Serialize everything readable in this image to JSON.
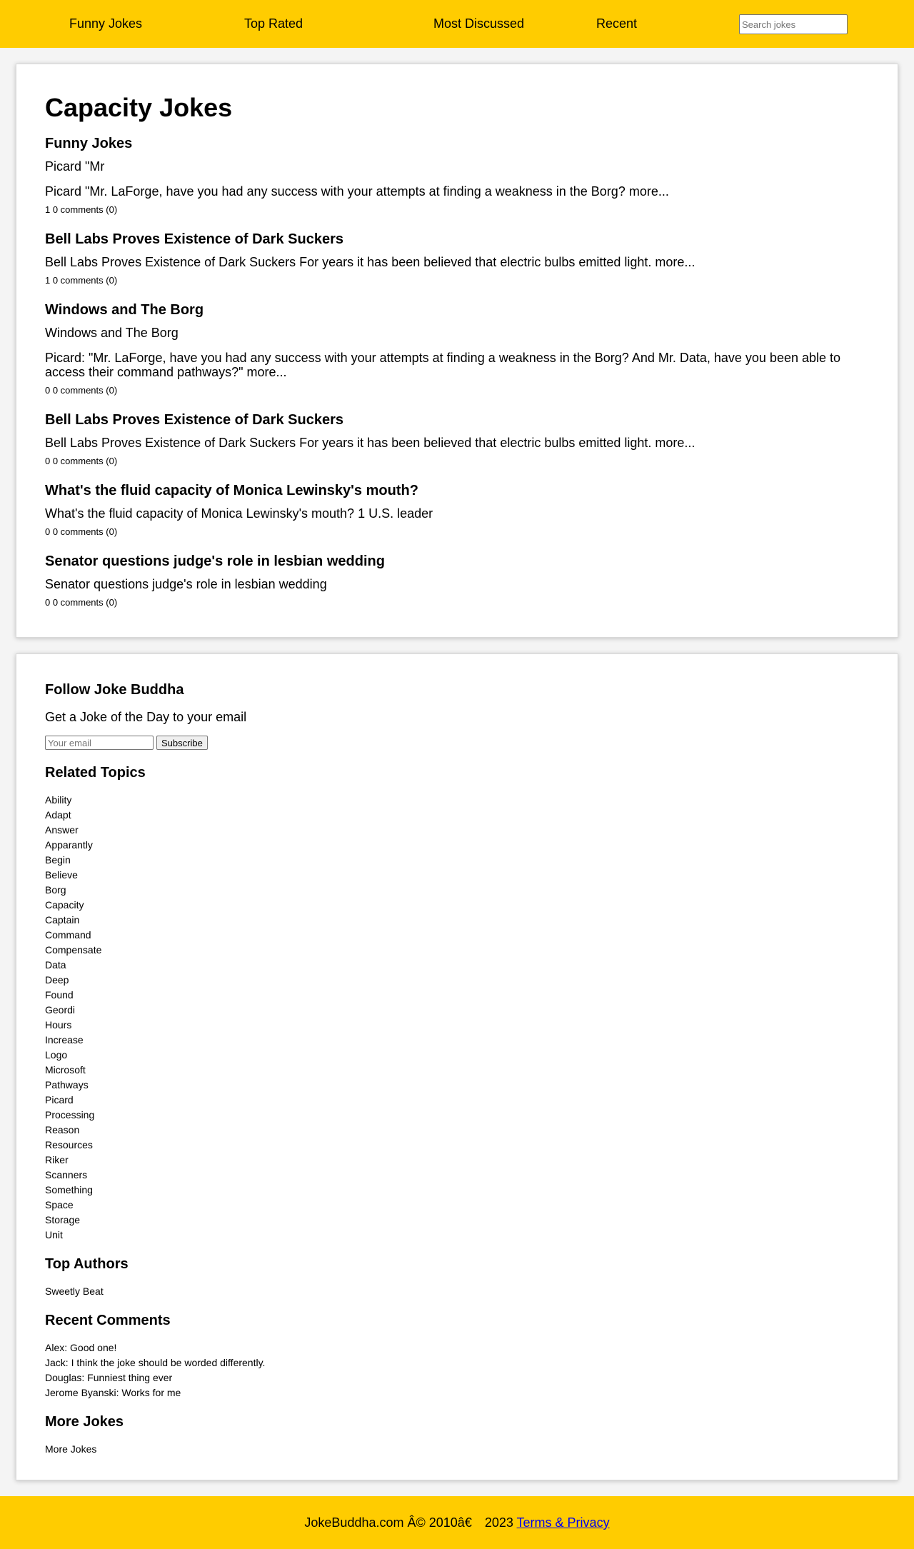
{
  "nav": {
    "items": [
      {
        "label": "Funny Jokes"
      },
      {
        "label": "Top Rated"
      },
      {
        "label": "Most Discussed"
      },
      {
        "label": "Recent"
      }
    ],
    "search_placeholder": "Search jokes"
  },
  "main": {
    "title": "Capacity Jokes",
    "jokes": [
      {
        "title": "Funny Jokes",
        "subtitle": "Picard \"Mr",
        "body": "Picard \"Mr. LaForge, have you had any success with your attempts at finding a weakness in the Borg? more...",
        "meta": "1 0 comments (0)"
      },
      {
        "title": "Bell Labs Proves Existence of Dark Suckers",
        "body": "Bell Labs Proves Existence of Dark Suckers For years it has been believed that electric bulbs emitted light. more...",
        "meta": "1 0 comments (0)"
      },
      {
        "title": "Windows and The Borg",
        "subtitle": "Windows and The Borg",
        "body": "Picard: \"Mr. LaForge, have you had any success with your attempts at finding a weakness in the Borg? And Mr. Data, have you been able to access their command pathways?\" more...",
        "meta": "0 0 comments (0)"
      },
      {
        "title": "Bell Labs Proves Existence of Dark Suckers",
        "body": "Bell Labs Proves Existence of Dark Suckers For years it has been believed that electric bulbs emitted light. more...",
        "meta": "0 0 comments (0)"
      },
      {
        "title": "What's the fluid capacity of Monica Lewinsky's mouth?",
        "body": "What's the fluid capacity of Monica Lewinsky's mouth? 1 U.S. leader",
        "meta": "0 0 comments (0)"
      },
      {
        "title": "Senator questions judge's role in lesbian wedding",
        "body": "Senator questions judge's role in lesbian wedding",
        "meta": "0 0 comments (0)"
      }
    ]
  },
  "sidebar": {
    "follow_title": "Follow Joke Buddha",
    "follow_desc": "Get a Joke of the Day to your email",
    "email_placeholder": "Your email",
    "subscribe_label": "Subscribe",
    "related_title": "Related Topics",
    "topics": [
      "Ability",
      "Adapt",
      "Answer",
      "Apparantly",
      "Begin",
      "Believe",
      "Borg",
      "Capacity",
      "Captain",
      "Command",
      "Compensate",
      "Data",
      "Deep",
      "Found",
      "Geordi",
      "Hours",
      "Increase",
      "Logo",
      "Microsoft",
      "Pathways",
      "Picard",
      "Processing",
      "Reason",
      "Resources",
      "Riker",
      "Scanners",
      "Something",
      "Space",
      "Storage",
      "Unit"
    ],
    "authors_title": "Top Authors",
    "author": "Sweetly Beat",
    "comments_title": "Recent Comments",
    "comments": [
      "Alex: Good one!",
      "Jack: I think the joke should be worded differently.",
      "Douglas: Funniest thing ever",
      "Jerome Byanski: Works for me"
    ],
    "more_title": "More Jokes",
    "more_link": "More Jokes"
  },
  "footer": {
    "text": "JokeBuddha.com Â© 2010â€  2023 ",
    "link_label": "Terms & Privacy"
  }
}
